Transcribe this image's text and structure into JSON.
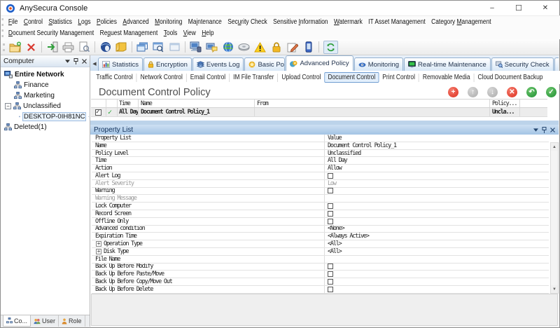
{
  "titlebar": {
    "title": "AnySecura Console"
  },
  "window_controls": {
    "minimize": "–",
    "maximize": "☐",
    "close": "✕"
  },
  "menubar1": [
    {
      "label": "File",
      "u": 0
    },
    {
      "label": "Control",
      "u": 0
    },
    {
      "label": "Statistics",
      "u": 0
    },
    {
      "label": "Logs",
      "u": 0
    },
    {
      "label": "Policies",
      "u": 0
    },
    {
      "label": "Advanced",
      "u": 0
    },
    {
      "label": "Monitoring",
      "u": 0
    },
    {
      "label": "Maintenance",
      "u": 2
    },
    {
      "label": "Security Check",
      "u": 3
    },
    {
      "label": "Sensitive Information",
      "u": 10
    },
    {
      "label": "Watermark",
      "u": 0
    },
    {
      "label": "IT Asset Management",
      "u": -1
    },
    {
      "label": "Category Management",
      "u": 9
    }
  ],
  "menubar2": [
    {
      "label": "Document Security Management",
      "u": 0
    },
    {
      "label": "Request Management",
      "u": 2
    },
    {
      "label": "Tools",
      "u": 0
    },
    {
      "label": "View",
      "u": 0
    },
    {
      "label": "Help",
      "u": 0
    }
  ],
  "toolbar_icons": [
    "new-policy",
    "delete",
    "import",
    "print",
    "print-preview",
    "network-sphere",
    "notes",
    "copy-window",
    "search-window",
    "window-disabled",
    "computer",
    "computer-message",
    "globe",
    "disk",
    "warning",
    "lock",
    "edit",
    "mobile",
    "refresh"
  ],
  "sidebar": {
    "panel_title": "Computer",
    "tree": {
      "root": "Entire Network",
      "items": [
        "Finance",
        "Marketing",
        "Unclassified",
        "DESKTOP-0IH81NC",
        "Deleted(1)"
      ]
    },
    "tabs": [
      "Co...",
      "User",
      "Role"
    ]
  },
  "main_tabs": [
    {
      "label": "Statistics"
    },
    {
      "label": "Encryption"
    },
    {
      "label": "Events Log"
    },
    {
      "label": "Basic Policy"
    },
    {
      "label": "Advanced Policy",
      "active": true
    },
    {
      "label": "Monitoring"
    },
    {
      "label": "Real-time Maintenance"
    },
    {
      "label": "Security Check"
    },
    {
      "label": "Se..."
    }
  ],
  "sub_tabs": [
    {
      "label": "Traffic Control"
    },
    {
      "label": "Network Control"
    },
    {
      "label": "Email Control"
    },
    {
      "label": "IM File Transfer"
    },
    {
      "label": "Upload Control"
    },
    {
      "label": "Document Control",
      "active": true
    },
    {
      "label": "Print Control"
    },
    {
      "label": "Removable Media"
    },
    {
      "label": "Cloud Document Backup"
    }
  ],
  "content": {
    "title": "Document Control Policy",
    "buttons": [
      "add",
      "move-up",
      "move-down",
      "delete",
      "undo",
      "apply"
    ]
  },
  "policy_table": {
    "columns": {
      "time": "Time",
      "name": "Name",
      "from": "From",
      "policy": "Policy..."
    },
    "row": {
      "time": "All Day",
      "name": "Document Control Policy_1",
      "from": "",
      "policy": "Uncla..."
    }
  },
  "property_panel": {
    "header": "Property List",
    "col_label": "Property List",
    "col_value": "Value",
    "rows": [
      {
        "label": "Name",
        "value": "Document Control Policy_1"
      },
      {
        "label": "Policy Level",
        "value": "Unclassified"
      },
      {
        "label": "Time",
        "value": "All Day"
      },
      {
        "label": "Action",
        "value": "Allow"
      },
      {
        "label": "Alert Log",
        "value": "",
        "checkbox": true
      },
      {
        "label": "Alert Severity",
        "value": "Low",
        "gray": true
      },
      {
        "label": "Warning",
        "value": "",
        "checkbox": true
      },
      {
        "label": "Warning Message",
        "value": "",
        "gray": true
      },
      {
        "label": "Lock Computer",
        "value": "",
        "checkbox": true
      },
      {
        "label": "Record Screen",
        "value": "",
        "checkbox": true
      },
      {
        "label": "Offline Only",
        "value": "",
        "checkbox": true
      },
      {
        "label": "Advanced condition",
        "value": "<None>"
      },
      {
        "label": "Expiration Time",
        "value": "<Always Active>"
      },
      {
        "label": "Operation Type",
        "value": "<All>",
        "expand": true
      },
      {
        "label": "Disk Type",
        "value": "<All>",
        "expand": true
      },
      {
        "label": "File Name",
        "value": ""
      },
      {
        "label": "Back Up Before Modify",
        "value": "",
        "checkbox": true
      },
      {
        "label": "Back Up Before Paste/Move",
        "value": "",
        "checkbox": true
      },
      {
        "label": "Back Up Before Copy/Move Out",
        "value": "",
        "checkbox": true
      },
      {
        "label": "Back Up Before Delete",
        "value": "",
        "checkbox": true
      }
    ]
  }
}
